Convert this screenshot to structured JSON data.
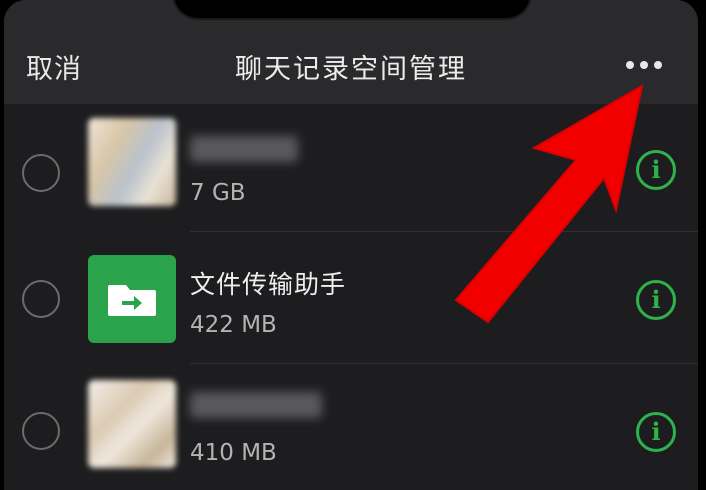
{
  "navbar": {
    "cancel_label": "取消",
    "title": "聊天记录空间管理",
    "more_icon": "more-horizontal-icon"
  },
  "items": [
    {
      "name": "",
      "size": "7 GB",
      "avatar": "blurred-photo",
      "name_blurred": true
    },
    {
      "name": "文件传输助手",
      "size": "422 MB",
      "avatar": "folder-transfer-icon",
      "name_blurred": false
    },
    {
      "name": "",
      "size": "410 MB",
      "avatar": "blurred-photo",
      "name_blurred": true
    }
  ],
  "info_glyph": "i",
  "colors": {
    "accent_green": "#2fb24b",
    "folder_green": "#2ba24c",
    "annotation_red": "#f20000"
  }
}
